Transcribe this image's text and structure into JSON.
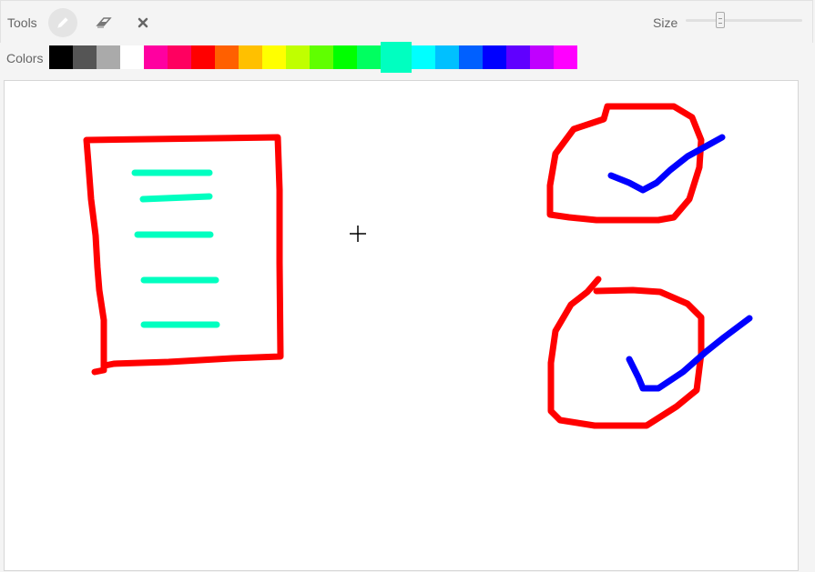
{
  "toolbar": {
    "tools_label": "Tools",
    "size_label": "Size",
    "size_value": 0.3,
    "active_tool": "pencil",
    "tools": [
      {
        "name": "pencil",
        "icon": "pencil-icon"
      },
      {
        "name": "eraser",
        "icon": "eraser-icon"
      },
      {
        "name": "clear",
        "icon": "close-icon"
      }
    ]
  },
  "palette": {
    "label": "Colors",
    "selected": "#00ffc0",
    "colors": [
      "#000000",
      "#555555",
      "#aaaaaa",
      "#ffffff",
      "#ff00a0",
      "#ff0060",
      "#ff0000",
      "#ff6000",
      "#ffc000",
      "#ffff00",
      "#c0ff00",
      "#60ff00",
      "#00ff00",
      "#00ff60",
      "#00ffc0",
      "#00ffff",
      "#00c0ff",
      "#0060ff",
      "#0000ff",
      "#6000ff",
      "#c000ff",
      "#ff00ff"
    ]
  },
  "canvas": {
    "stroke_colors": {
      "red": "#ff0000",
      "teal": "#00ffc0",
      "blue": "#0000ff"
    },
    "cursor": "crosshair-icon"
  }
}
